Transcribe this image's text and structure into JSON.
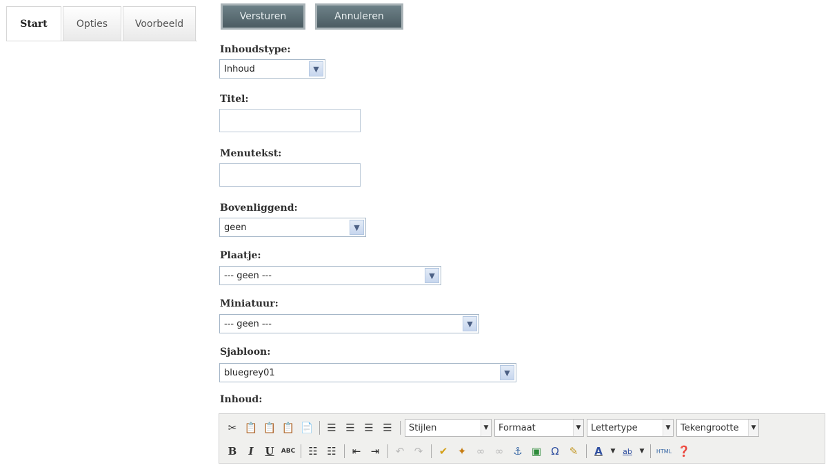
{
  "tabs": [
    {
      "label": "Start",
      "active": true
    },
    {
      "label": "Opties",
      "active": false
    },
    {
      "label": "Voorbeeld",
      "active": false
    }
  ],
  "actions": {
    "send_label": "Versturen",
    "cancel_label": "Annuleren"
  },
  "form": {
    "content_type": {
      "label": "Inhoudstype:",
      "value": "Inhoud"
    },
    "title": {
      "label": "Titel:",
      "value": ""
    },
    "menu_text": {
      "label": "Menutekst:",
      "value": ""
    },
    "parent": {
      "label": "Bovenliggend:",
      "value": "geen"
    },
    "image": {
      "label": "Plaatje:",
      "value": "--- geen ---"
    },
    "thumbnail": {
      "label": "Miniatuur:",
      "value": "--- geen ---"
    },
    "template": {
      "label": "Sjabloon:",
      "value": "bluegrey01"
    },
    "content": {
      "label": "Inhoud:"
    }
  },
  "editor": {
    "styles_label": "Stijlen",
    "format_label": "Formaat",
    "font_label": "Lettertype",
    "size_label": "Tekengrootte",
    "html_label": "HTML",
    "bold_glyph": "B",
    "italic_glyph": "I",
    "underline_glyph": "U",
    "strike_glyph": "ABC",
    "abv_glyph": "ab"
  },
  "colors": {
    "button_bg": "#56696f",
    "select_border": "#a6b7c8",
    "toolbar_bg": "#f0f0ee"
  }
}
